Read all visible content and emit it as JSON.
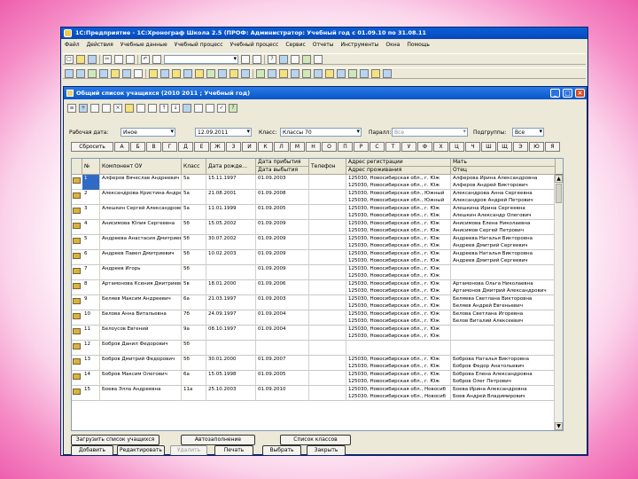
{
  "window": {
    "title": "1С:Предприятие - 1С:Хронограф Школа 2.5 (ПРОФ: Администратор: Учебный год с 01.09.10 по 31.08.11"
  },
  "menu": [
    "Файл",
    "Действия",
    "Учебные данные",
    "Учебный процесс",
    "Учебный процесс",
    "Сервис",
    "Отчеты",
    "Инструменты",
    "Окна",
    "Помощь"
  ],
  "child": {
    "title": "Общий список учащихся (2010 2011 ; Учебный год)",
    "min": "_",
    "max": "□",
    "close": "×"
  },
  "filters": {
    "working_date_label": "Рабочая дата:",
    "working_date_combo": "Иное",
    "working_date_value": "12.09.2011",
    "class_label": "Класс:",
    "class_value": "Классы 70",
    "parallel_label": "Паралл:",
    "parallel_value": "Все",
    "subgroup_label": "Подгруппы:",
    "subgroup_value": "Все"
  },
  "alphabet": {
    "reset": "Сбросить",
    "letters": [
      "А",
      "Б",
      "В",
      "Г",
      "Д",
      "Е",
      "Ж",
      "З",
      "И",
      "К",
      "Л",
      "М",
      "Н",
      "О",
      "П",
      "Р",
      "С",
      "Т",
      "У",
      "Ф",
      "Х",
      "Ц",
      "Ч",
      "Ш",
      "Щ",
      "Э",
      "Ю",
      "Я"
    ]
  },
  "grid": {
    "headers": {
      "icon": "",
      "num": "№",
      "name": "Компонент ОУ",
      "class": "Класс",
      "birth": "Дата рожде...",
      "arrival": "Дата прибытия",
      "departure": "Дата выбытия",
      "phone": "Телефон",
      "reg": "Адрес регистрации",
      "live": "Адрес проживания",
      "mother": "Мать",
      "father": "Отец"
    },
    "rows": [
      {
        "num": "1",
        "name": "Алферов Вячеслав Андреевич",
        "class": "5а",
        "birth": "15.11.1997",
        "arr": "01.09.2003",
        "dep": "",
        "reg": "125030, Новосибирская обл., г. Юж",
        "live": "125030, Новосибирская обл., г. Юж",
        "mother": "Алферова Ирина Александровна",
        "father": "Алферов Андрей Викторович",
        "selected": true
      },
      {
        "num": "2",
        "name": "Александрова Кристина Андреевна",
        "class": "5а",
        "birth": "21.08.2001",
        "arr": "01.09.2008",
        "dep": "",
        "reg": "125030, Новосибирская обл., Южный",
        "live": "125030, Новосибирская обл., Южный",
        "mother": "Александрова Анна Сергеевна",
        "father": "Александров Андрей Петрович",
        "selected": false
      },
      {
        "num": "3",
        "name": "Алешкин Сергей Александрович",
        "class": "5а",
        "birth": "11.01.1999",
        "arr": "01.09.2005",
        "dep": "",
        "reg": "125030, Новосибирская обл., г. Юж",
        "live": "125030, Новосибирская обл., г. Юж",
        "mother": "Алешкина Ирина Сергеевна",
        "father": "Алешкин Александр Олегович",
        "selected": false
      },
      {
        "num": "4",
        "name": "Анисимова Юлия Сергеевна",
        "class": "5б",
        "birth": "15.05.2002",
        "arr": "01.09.2009",
        "dep": "",
        "reg": "125030, Новосибирская обл., г. Юж",
        "live": "125030, Новосибирская обл., г. Юж",
        "mother": "Анисимова Елена Николаевна",
        "father": "Анисимов Сергей Петрович",
        "selected": false
      },
      {
        "num": "5",
        "name": "Андреева Анастасия Дмитриевна",
        "class": "5б",
        "birth": "30.07.2002",
        "arr": "01.09.2009",
        "dep": "",
        "reg": "125030, Новосибирская обл., г. Юж",
        "live": "125030, Новосибирская обл., г. Юж",
        "mother": "Андреева Наталья Викторовна",
        "father": "Андреев Дмитрий Сергеевич",
        "selected": false
      },
      {
        "num": "6",
        "name": "Андреев Павел Дмитриевич",
        "class": "5б",
        "birth": "10.02.2003",
        "arr": "01.09.2009",
        "dep": "",
        "reg": "125030, Новосибирская обл., г. Юж",
        "live": "125030, Новосибирская обл., г. Юж",
        "mother": "Андреева Наталья Викторовна",
        "father": "Андреев Дмитрий Сергеевич",
        "selected": false
      },
      {
        "num": "7",
        "name": "Андреев Игорь",
        "class": "5б",
        "birth": "",
        "arr": "01.09.2009",
        "dep": "",
        "reg": "125030, Новосибирская обл., г. Юж",
        "live": "125030, Новосибирская обл., г. Юж",
        "mother": "",
        "father": "",
        "selected": false
      },
      {
        "num": "8",
        "name": "Артамонова Ксения Дмитриевна",
        "class": "5в",
        "birth": "18.01.2000",
        "arr": "01.09.2006",
        "dep": "",
        "reg": "125030, Новосибирская обл., г. Юж",
        "live": "125030, Новосибирская обл., г. Юж",
        "mother": "Артамонова Ольга Николаевна",
        "father": "Артамонов Дмитрий Александрович",
        "selected": false
      },
      {
        "num": "9",
        "name": "Беляев Максим Андреевич",
        "class": "6а",
        "birth": "21.03.1997",
        "arr": "01.09.2003",
        "dep": "",
        "reg": "125030, Новосибирская обл., г. Юж",
        "live": "125030, Новосибирская обл., г. Юж",
        "mother": "Беляева Светлана Викторовна",
        "father": "Беляев Андрей Евгеньевич",
        "selected": false
      },
      {
        "num": "10",
        "name": "Белова Анна Витальевна",
        "class": "7б",
        "birth": "24.09.1997",
        "arr": "01.09.2004",
        "dep": "",
        "reg": "125030, Новосибирская обл., г. Юж",
        "live": "125030, Новосибирская обл., г. Юж",
        "mother": "Белова Светлана Игоревна",
        "father": "Белов Виталий Алексеевич",
        "selected": false
      },
      {
        "num": "11",
        "name": "Белоусов Евгений",
        "class": "9а",
        "birth": "08.10.1997",
        "arr": "01.09.2004",
        "dep": "",
        "reg": "125030, Новосибирская обл., г. Юж",
        "live": "125030, Новосибирская обл., г. Юж",
        "mother": "",
        "father": "",
        "selected": false
      },
      {
        "num": "12",
        "name": "Бобров Данил Федорович",
        "class": "5б",
        "birth": "",
        "arr": "",
        "dep": "",
        "reg": "",
        "live": "",
        "mother": "",
        "father": "",
        "selected": false
      },
      {
        "num": "13",
        "name": "Бобров Дмитрий Федорович",
        "class": "5б",
        "birth": "30.01.2000",
        "arr": "01.09.2007",
        "dep": "",
        "reg": "125030, Новосибирская обл., г. Юж",
        "live": "125030, Новосибирская обл., г. Юж",
        "mother": "Боброва Наталья Викторовна",
        "father": "Бобров Федор Анатольевич",
        "selected": false
      },
      {
        "num": "14",
        "name": "Бобров Максим Олегович",
        "class": "6а",
        "birth": "15.05.1998",
        "arr": "01.09.2005",
        "dep": "",
        "reg": "125030, Новосибирская обл., г. Юж",
        "live": "125030, Новосибирская обл., г. Юж",
        "mother": "Боброва Елена Александровна",
        "father": "Бобров Олег Петрович",
        "selected": false
      },
      {
        "num": "15",
        "name": "Боева Элла Андреевна",
        "class": "11а",
        "birth": "25.10.2003",
        "arr": "01.09.2010",
        "dep": "",
        "reg": "125030, Новосибирская обл., Новосиб",
        "live": "125030, Новосибирская обл., Новосиб",
        "mother": "Боева Ирина Александровна",
        "father": "Боев Андрей Владимирович",
        "selected": false
      }
    ]
  },
  "buttons": {
    "row1": [
      "Загрузить список учащихся",
      "Автозаполнение",
      "Список классов"
    ],
    "row2": [
      "Добавить",
      "Редактировать",
      "Удалить",
      "Печать",
      "Выбрать",
      "Закрыть"
    ]
  },
  "colors": {
    "titlebar": "#0a5fd8",
    "selection": "#316ac5",
    "frame_pink": "#ee5fae"
  }
}
